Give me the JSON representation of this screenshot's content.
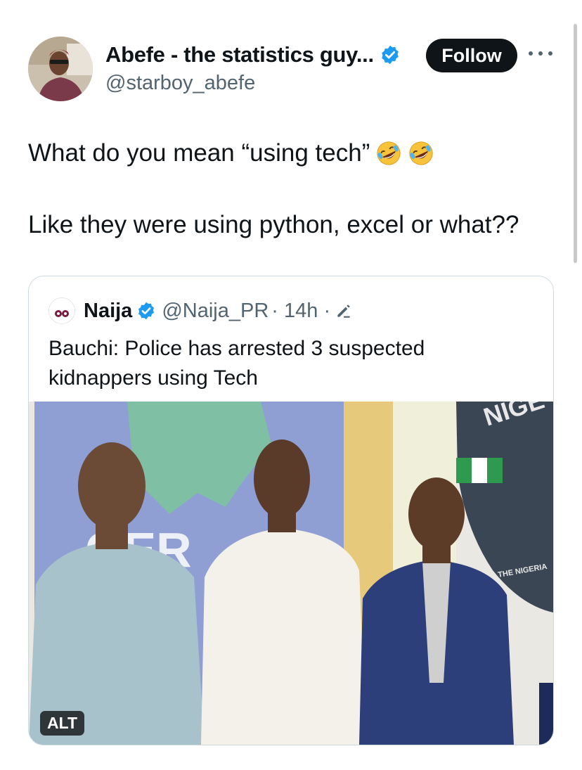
{
  "tweet": {
    "author_name": "Abefe - the statistics guy...",
    "author_handle": "@starboy_abefe",
    "follow_label": "Follow",
    "text_line1": "What do you mean “using tech”",
    "text_line2": "Like they were using python, excel or what??",
    "emoji": "rolling-on-floor-laughing",
    "verified_color": "#1d9bf0"
  },
  "quoted": {
    "name": "Naija",
    "handle": "@Naija_PR",
    "time": "· 14h ·",
    "text": "Bauchi: Police has arrested 3 suspected kidnappers using Tech",
    "alt_label": "ALT",
    "photo_text_nigeria": "GER",
    "photo_text_police": "NIGE POL",
    "photo_text_badge": "THE NIGERIA"
  }
}
